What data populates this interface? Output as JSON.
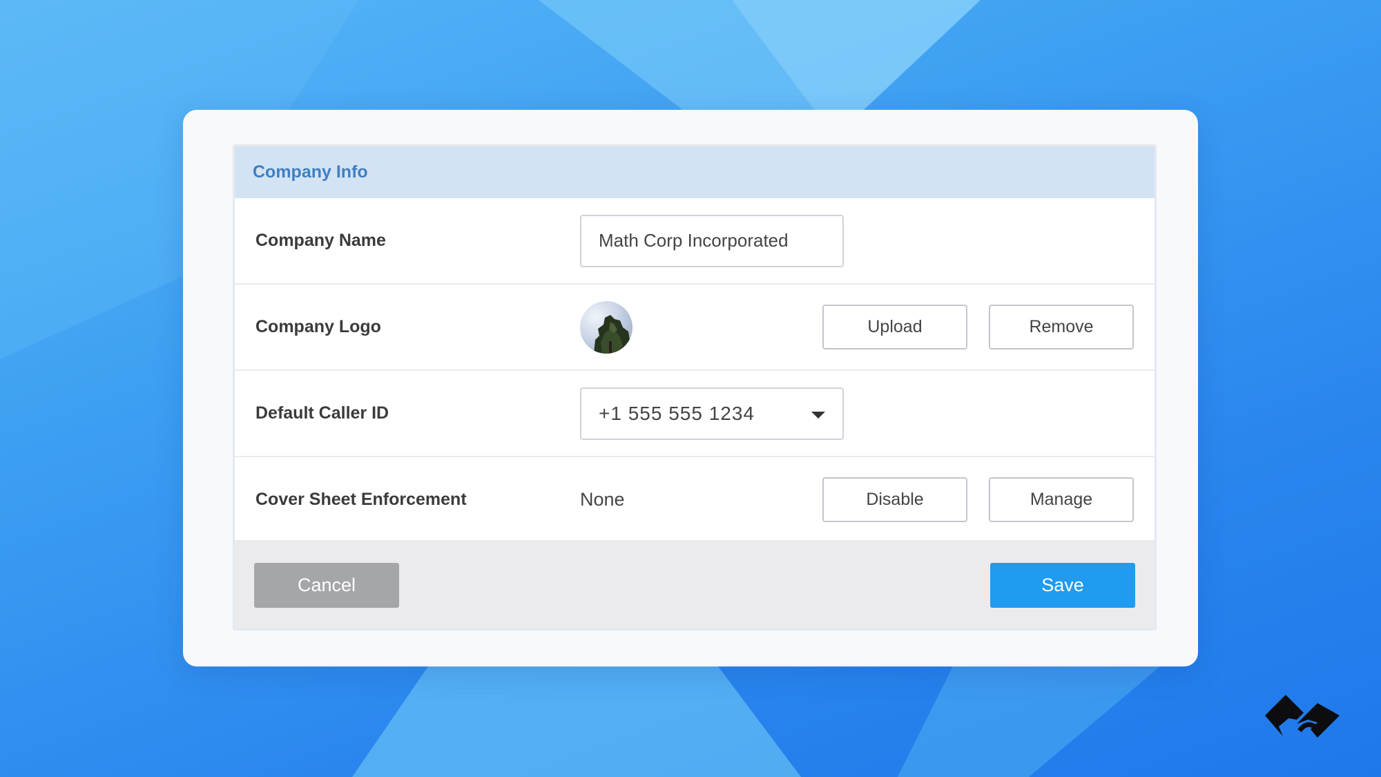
{
  "panel": {
    "title": "Company Info"
  },
  "rows": {
    "company_name": {
      "label": "Company Name",
      "value": "Math Corp Incorporated"
    },
    "company_logo": {
      "label": "Company Logo",
      "upload_label": "Upload",
      "remove_label": "Remove"
    },
    "caller_id": {
      "label": "Default Caller ID",
      "selected": "+1 555 555 1234"
    },
    "cover_sheet": {
      "label": "Cover Sheet Enforcement",
      "value": "None",
      "disable_label": "Disable",
      "manage_label": "Manage"
    }
  },
  "footer": {
    "cancel_label": "Cancel",
    "save_label": "Save"
  },
  "colors": {
    "header_bg": "#d4e3f3",
    "title": "#3f7fc4",
    "save": "#1f9bf0",
    "cancel": "#a5a6aa"
  },
  "icons": {
    "logo_avatar": "tree-photo",
    "dropdown": "chevron-down-icon",
    "brand": "brand-logo"
  }
}
